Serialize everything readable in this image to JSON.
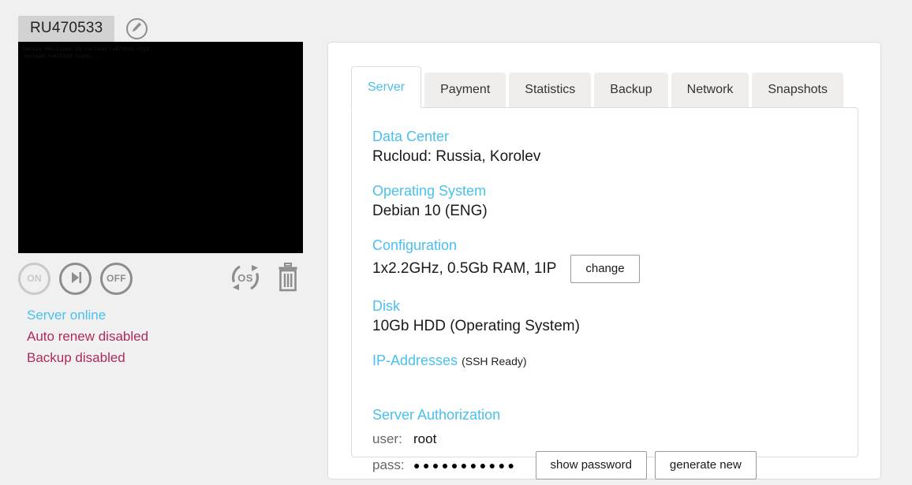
{
  "page": {
    "background_color": "#f0f0f0",
    "accent_color": "#49c0f0",
    "alert_color": "#ae2a5d"
  },
  "server_panel": {
    "server_id_label": "RU470533",
    "edit_icon": "pencil-icon",
    "console": {
      "text": "Debian GNU/Linux 10 rucloud-ru470533 tty1\nrucloud-ru470533 login: _"
    },
    "power_controls": [
      {
        "id": "power-on",
        "label": "ON",
        "icon": "power-on-icon",
        "disabled": true
      },
      {
        "id": "reboot",
        "label": "",
        "icon": "reboot-icon",
        "disabled": false
      },
      {
        "id": "power-off",
        "label": "OFF",
        "icon": "power-off-icon",
        "disabled": false
      }
    ],
    "maintenance_controls": [
      {
        "id": "reinstall-os",
        "label": "OS",
        "icon": "reinstall-os-icon"
      },
      {
        "id": "delete-server",
        "label": "",
        "icon": "trash-icon"
      }
    ],
    "statuses": [
      {
        "text": "Server online",
        "state": "online"
      },
      {
        "text": "Auto renew disabled",
        "state": "disabled"
      },
      {
        "text": "Backup disabled",
        "state": "disabled"
      }
    ]
  },
  "details_card": {
    "tabs": [
      {
        "label": "Server",
        "active": true
      },
      {
        "label": "Payment",
        "active": false
      },
      {
        "label": "Statistics",
        "active": false
      },
      {
        "label": "Backup",
        "active": false
      },
      {
        "label": "Network",
        "active": false
      },
      {
        "label": "Snapshots",
        "active": false
      }
    ],
    "sections": {
      "data_center": {
        "label": "Data Center",
        "value": "Rucloud: Russia, Korolev"
      },
      "operating_system": {
        "label": "Operating System",
        "value": "Debian 10 (ENG)"
      },
      "configuration": {
        "label": "Configuration",
        "value": "1x2.2GHz, 0.5Gb RAM, 1IP",
        "change_button": "change"
      },
      "disk": {
        "label": "Disk",
        "value": "10Gb HDD (Operating System)"
      },
      "ip_addresses": {
        "label": "IP-Addresses",
        "suffix": "(SSH Ready)"
      },
      "authorization": {
        "label": "Server Authorization",
        "user_key": "user:",
        "user_value": "root",
        "pass_key": "pass:",
        "pass_masked": "●●●●●●●●●●●",
        "show_password_button": "show password",
        "generate_button": "generate new"
      }
    }
  }
}
